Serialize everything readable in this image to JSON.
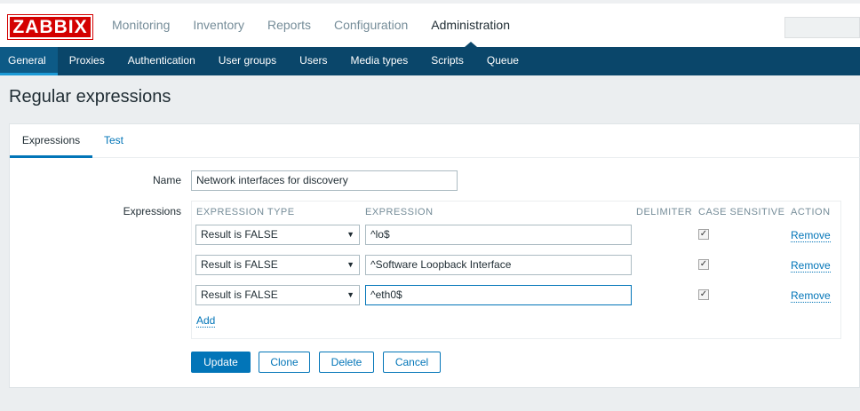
{
  "logo": "ZABBIX",
  "topnav": [
    "Monitoring",
    "Inventory",
    "Reports",
    "Configuration",
    "Administration"
  ],
  "subnav": [
    "General",
    "Proxies",
    "Authentication",
    "User groups",
    "Users",
    "Media types",
    "Scripts",
    "Queue"
  ],
  "page_title": "Regular expressions",
  "tabs": {
    "expressions": "Expressions",
    "test": "Test"
  },
  "form": {
    "name_label": "Name",
    "name_value": "Network interfaces for discovery",
    "expressions_label": "Expressions"
  },
  "table": {
    "headers": {
      "type": "EXPRESSION TYPE",
      "expression": "EXPRESSION",
      "delimiter": "DELIMITER",
      "case": "CASE SENSITIVE",
      "action": "ACTION"
    },
    "rows": [
      {
        "type": "Result is FALSE",
        "expression": "^lo$",
        "case_sensitive": true,
        "action": "Remove"
      },
      {
        "type": "Result is FALSE",
        "expression": "^Software Loopback Interface",
        "case_sensitive": true,
        "action": "Remove"
      },
      {
        "type": "Result is FALSE",
        "expression": "^eth0$",
        "case_sensitive": true,
        "action": "Remove"
      }
    ],
    "add_label": "Add"
  },
  "buttons": {
    "update": "Update",
    "clone": "Clone",
    "delete": "Delete",
    "cancel": "Cancel"
  },
  "colors": {
    "brand": "#d40000",
    "nav": "#0a466a",
    "accent": "#0275b8"
  }
}
